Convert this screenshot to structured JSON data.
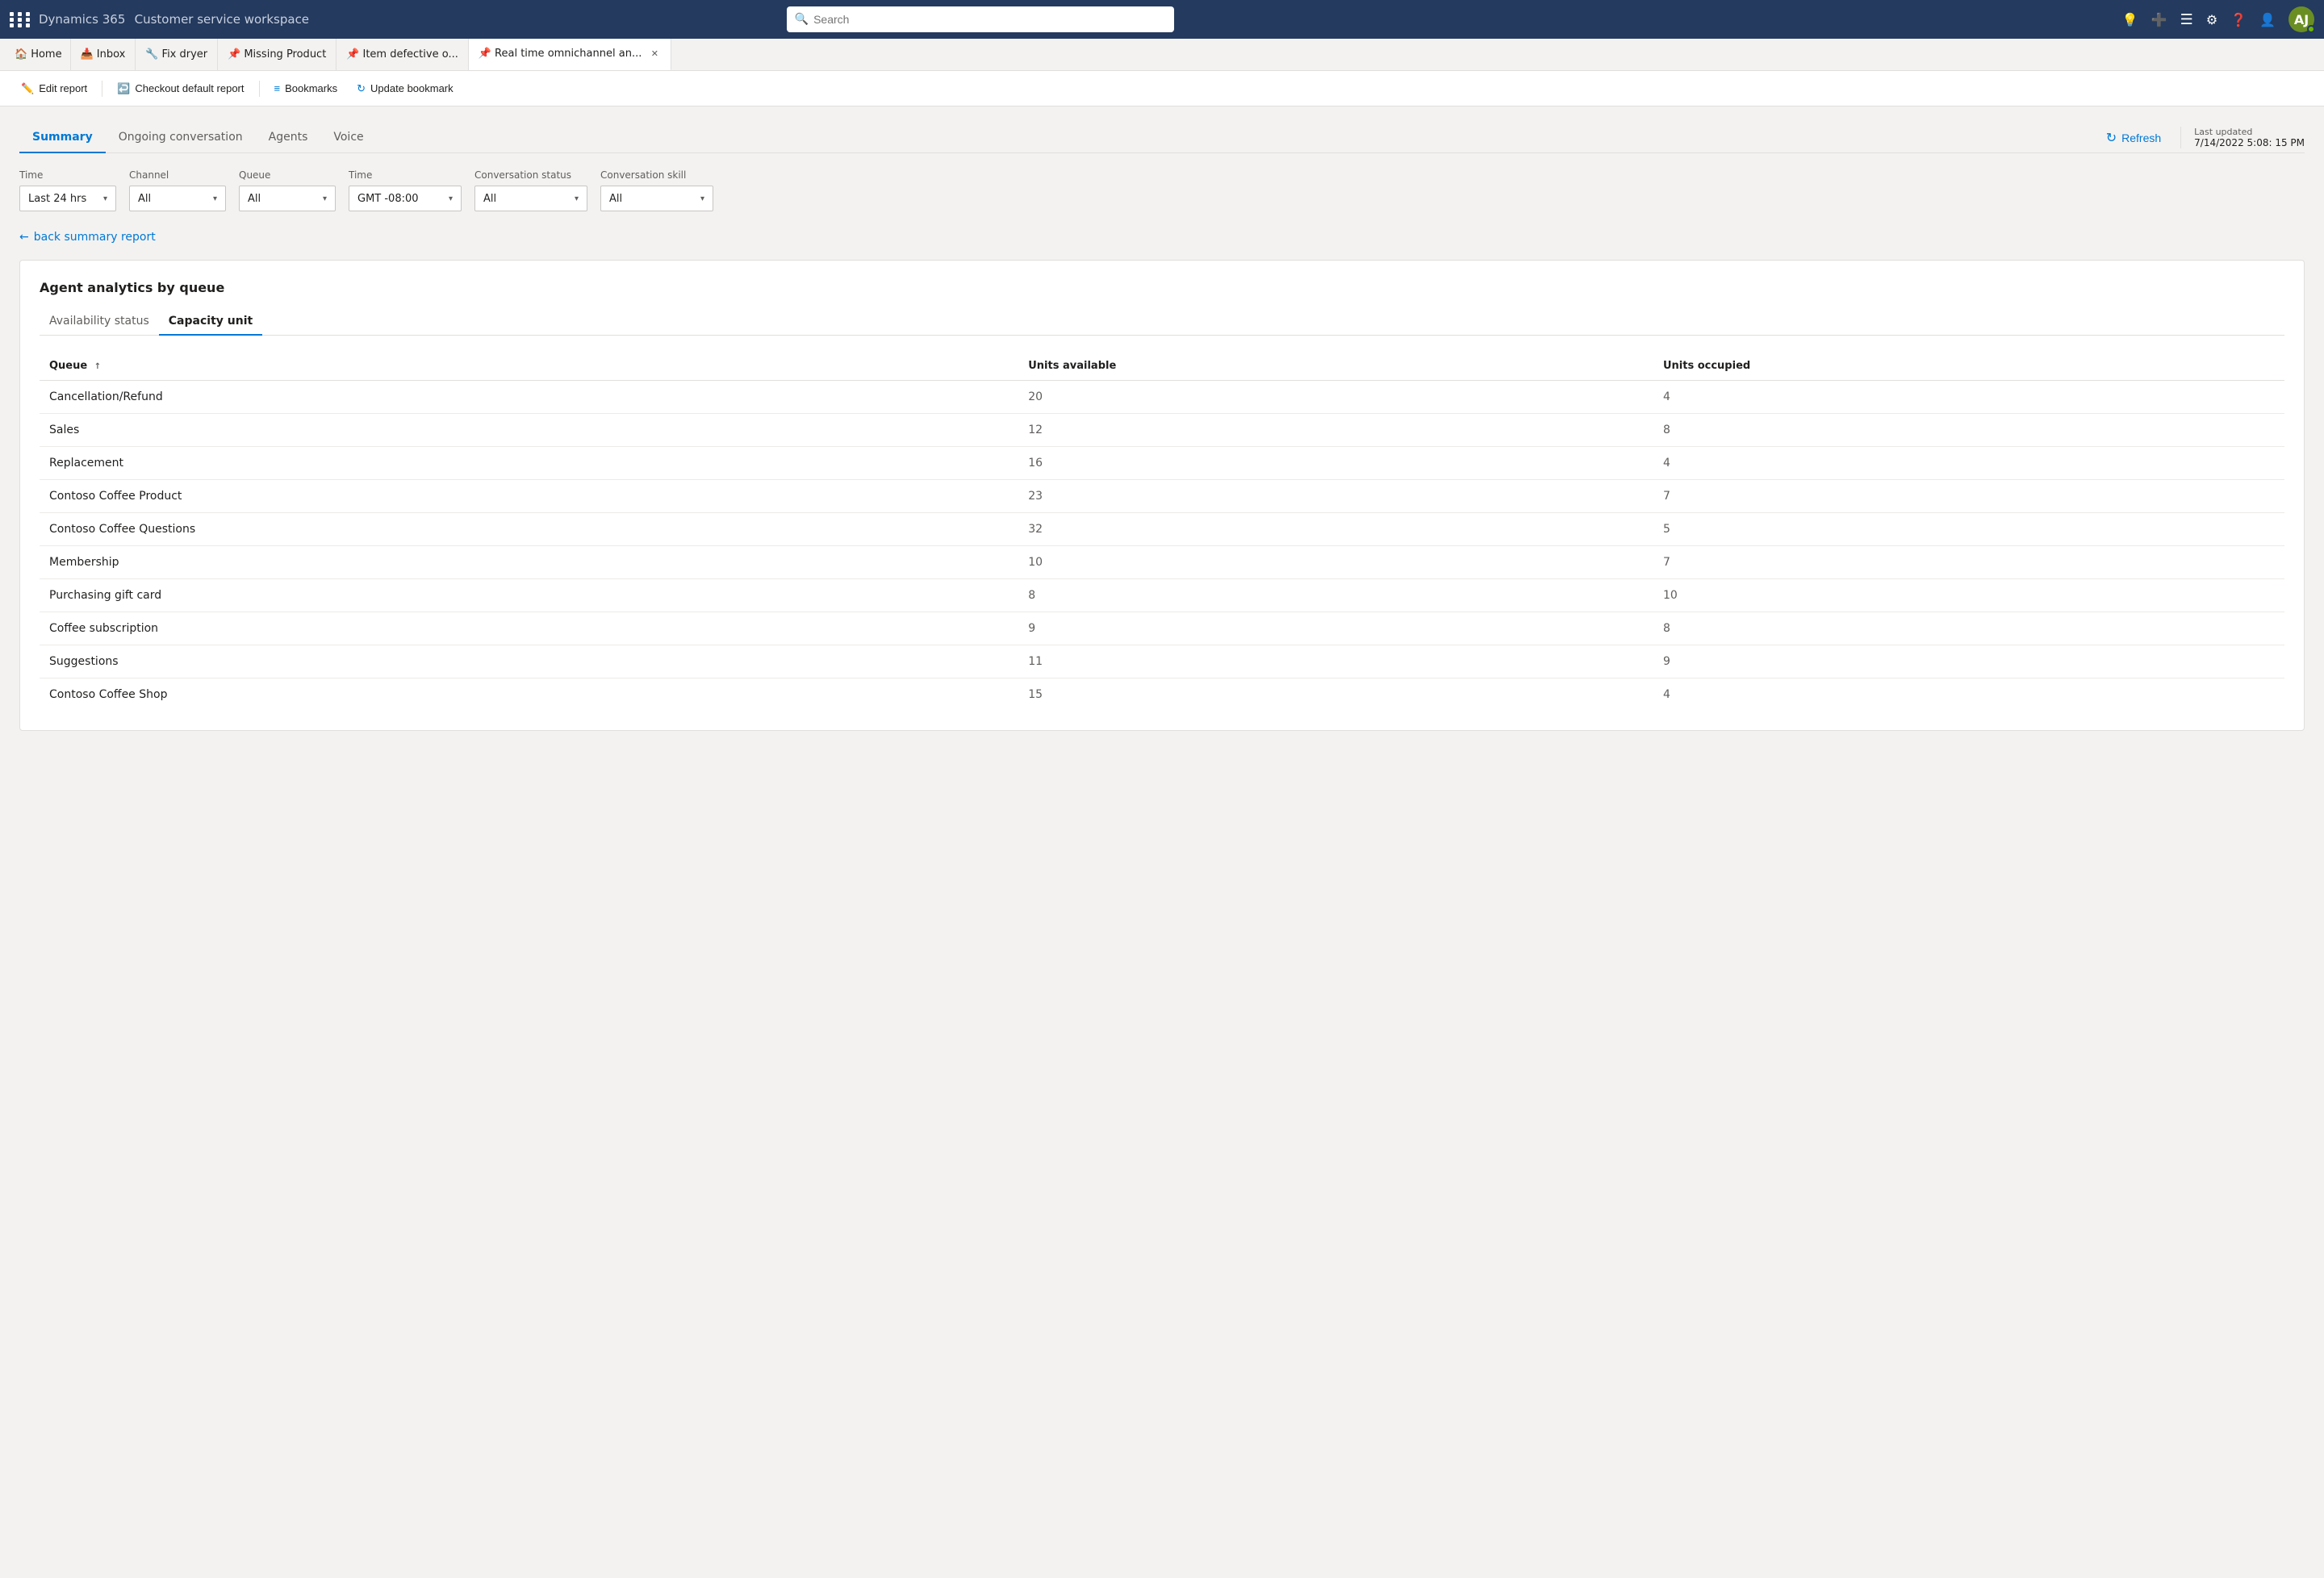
{
  "app": {
    "name": "Dynamics 365",
    "subtitle": "Customer service workspace",
    "search_placeholder": "Search"
  },
  "nav_icons": [
    "lightbulb",
    "plus",
    "lines",
    "gear",
    "question",
    "person"
  ],
  "tabs": [
    {
      "id": "home",
      "label": "Home",
      "icon": "home",
      "active": false,
      "closable": false
    },
    {
      "id": "inbox",
      "label": "Inbox",
      "icon": "inbox",
      "active": false,
      "closable": false
    },
    {
      "id": "fix-dryer",
      "label": "Fix dryer",
      "icon": "wrench",
      "active": false,
      "closable": true
    },
    {
      "id": "missing-product",
      "label": "Missing Product",
      "icon": "pin",
      "active": false,
      "closable": true
    },
    {
      "id": "item-defective",
      "label": "Item defective o...",
      "icon": "pin",
      "active": false,
      "closable": true
    },
    {
      "id": "realtime",
      "label": "Real time omnichannel an...",
      "icon": "pin",
      "active": true,
      "closable": true
    }
  ],
  "toolbar": {
    "buttons": [
      {
        "id": "edit-report",
        "label": "Edit report",
        "icon": "edit"
      },
      {
        "id": "checkout",
        "label": "Checkout default report",
        "icon": "checkout"
      },
      {
        "id": "bookmarks",
        "label": "Bookmarks",
        "icon": "bookmarks"
      },
      {
        "id": "update-bookmark",
        "label": "Update bookmark",
        "icon": "refresh-small"
      }
    ]
  },
  "report_tabs": [
    {
      "id": "summary",
      "label": "Summary",
      "active": true
    },
    {
      "id": "ongoing",
      "label": "Ongoing conversation",
      "active": false
    },
    {
      "id": "agents",
      "label": "Agents",
      "active": false
    },
    {
      "id": "voice",
      "label": "Voice",
      "active": false
    }
  ],
  "refresh": {
    "button_label": "Refresh",
    "last_updated_label": "Last updated",
    "last_updated_value": "7/14/2022 5:08: 15 PM"
  },
  "filters": [
    {
      "id": "time1",
      "label": "Time",
      "value": "Last 24 hrs"
    },
    {
      "id": "channel",
      "label": "Channel",
      "value": "All"
    },
    {
      "id": "queue",
      "label": "Queue",
      "value": "All"
    },
    {
      "id": "time2",
      "label": "Time",
      "value": "GMT -08:00"
    },
    {
      "id": "conv-status",
      "label": "Conversation status",
      "value": "All"
    },
    {
      "id": "conv-skill",
      "label": "Conversation skill",
      "value": "All"
    }
  ],
  "back_link": "back summary report",
  "card": {
    "title": "Agent analytics by queue",
    "inner_tabs": [
      {
        "id": "availability",
        "label": "Availability status",
        "active": false
      },
      {
        "id": "capacity",
        "label": "Capacity unit",
        "active": true
      }
    ],
    "table": {
      "columns": [
        {
          "id": "queue",
          "label": "Queue",
          "sortable": true
        },
        {
          "id": "units-available",
          "label": "Units available",
          "sortable": false
        },
        {
          "id": "units-occupied",
          "label": "Units occupied",
          "sortable": false
        }
      ],
      "rows": [
        {
          "queue": "Cancellation/Refund",
          "units_available": "20",
          "units_occupied": "4"
        },
        {
          "queue": "Sales",
          "units_available": "12",
          "units_occupied": "8"
        },
        {
          "queue": "Replacement",
          "units_available": "16",
          "units_occupied": "4"
        },
        {
          "queue": "Contoso Coffee Product",
          "units_available": "23",
          "units_occupied": "7"
        },
        {
          "queue": "Contoso Coffee Questions",
          "units_available": "32",
          "units_occupied": "5"
        },
        {
          "queue": "Membership",
          "units_available": "10",
          "units_occupied": "7"
        },
        {
          "queue": "Purchasing gift card",
          "units_available": "8",
          "units_occupied": "10"
        },
        {
          "queue": "Coffee subscription",
          "units_available": "9",
          "units_occupied": "8"
        },
        {
          "queue": "Suggestions",
          "units_available": "11",
          "units_occupied": "9"
        },
        {
          "queue": "Contoso Coffee Shop",
          "units_available": "15",
          "units_occupied": "4"
        }
      ]
    }
  }
}
